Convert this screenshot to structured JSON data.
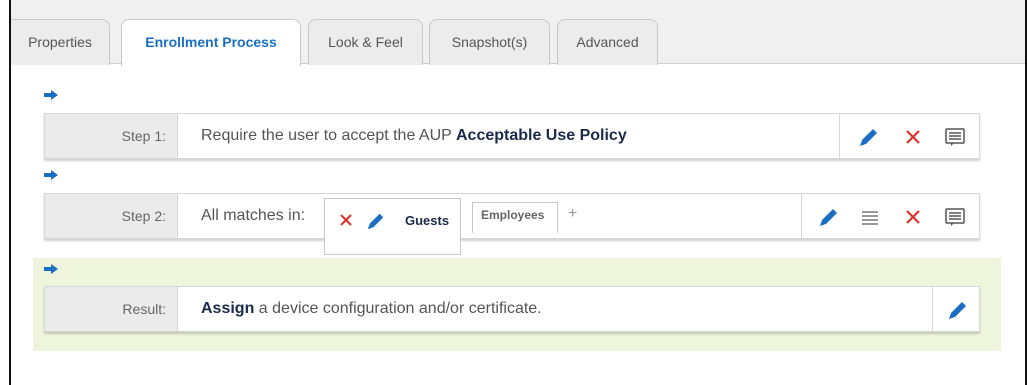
{
  "tabs": [
    {
      "label": "Properties"
    },
    {
      "label": "Enrollment Process"
    },
    {
      "label": "Look & Feel"
    },
    {
      "label": "Snapshot(s)"
    },
    {
      "label": "Advanced"
    }
  ],
  "active_tab": "Enrollment Process",
  "step1": {
    "label": "Step 1:",
    "text": "Require the user to accept the AUP",
    "link": "Acceptable Use Policy"
  },
  "step2": {
    "label": "Step 2:",
    "text": "All matches in:",
    "subtabs": [
      {
        "label": "Guests"
      },
      {
        "label": "Employees"
      }
    ],
    "add_symbol": "+"
  },
  "result": {
    "label": "Result:",
    "action": "Assign",
    "text": "a device configuration and/or certificate."
  },
  "colors": {
    "accent_blue": "#1a6fc2",
    "delete_red": "#d9342b",
    "result_bg": "#eef5dc",
    "arrow_blue": "#1a6fc2"
  },
  "icons": [
    "arrow-right-icon",
    "pencil-icon",
    "close-icon",
    "comment-icon",
    "list-icon"
  ]
}
